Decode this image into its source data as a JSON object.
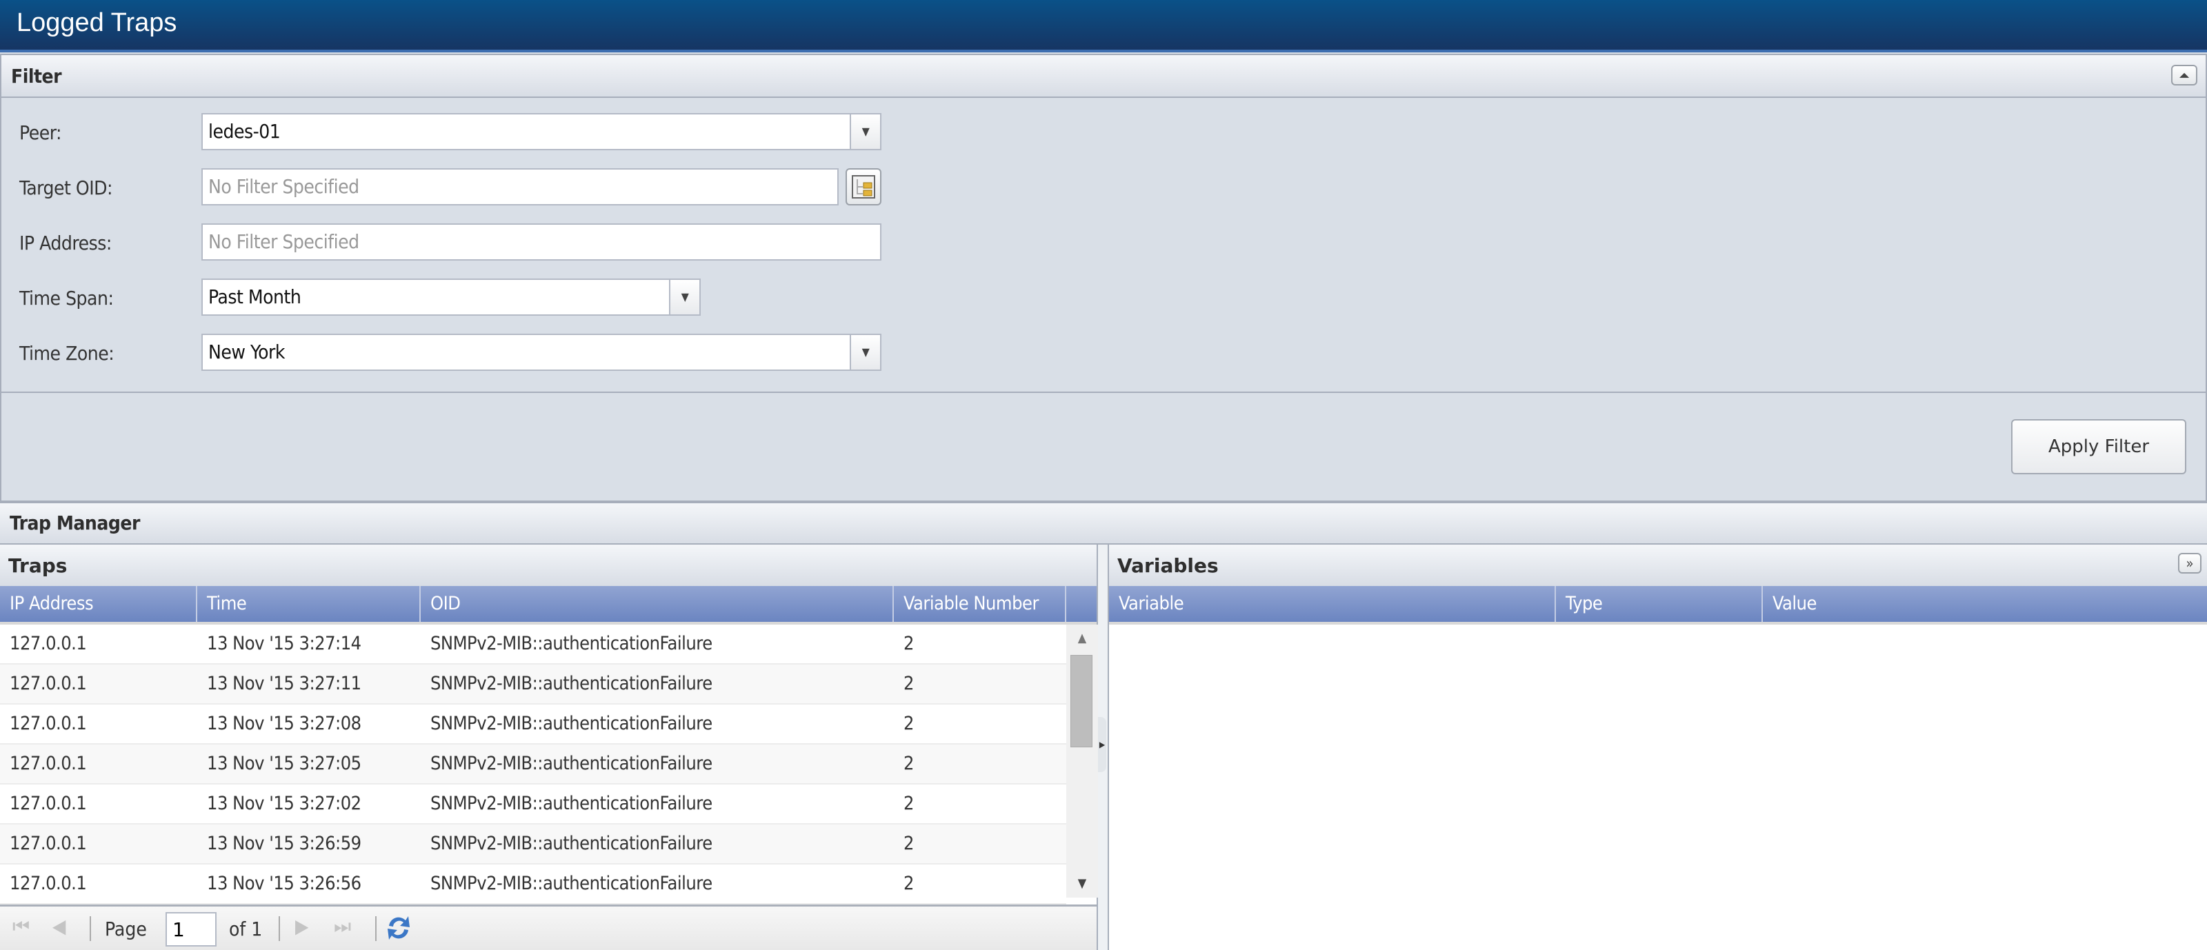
{
  "window": {
    "title": "Logged Traps"
  },
  "filter": {
    "title": "Filter",
    "collapse_icon": "double-chevron-up-icon",
    "fields": {
      "peer": {
        "label": "Peer:",
        "value": "ledes-01"
      },
      "target_oid": {
        "label": "Target OID:",
        "value": "",
        "placeholder": "No Filter Specified"
      },
      "ip_address": {
        "label": "IP Address:",
        "value": "",
        "placeholder": "No Filter Specified"
      },
      "time_span": {
        "label": "Time Span:",
        "value": "Past Month"
      },
      "time_zone": {
        "label": "Time Zone:",
        "value": "New York"
      }
    },
    "apply_label": "Apply Filter"
  },
  "trap_manager": {
    "title": "Trap Manager",
    "traps": {
      "title": "Traps",
      "columns": [
        "IP Address",
        "Time",
        "OID",
        "Variable Number"
      ],
      "rows": [
        [
          "127.0.0.1",
          "13 Nov '15 3:27:14",
          "SNMPv2-MIB::authenticationFailure",
          "2"
        ],
        [
          "127.0.0.1",
          "13 Nov '15 3:27:11",
          "SNMPv2-MIB::authenticationFailure",
          "2"
        ],
        [
          "127.0.0.1",
          "13 Nov '15 3:27:08",
          "SNMPv2-MIB::authenticationFailure",
          "2"
        ],
        [
          "127.0.0.1",
          "13 Nov '15 3:27:05",
          "SNMPv2-MIB::authenticationFailure",
          "2"
        ],
        [
          "127.0.0.1",
          "13 Nov '15 3:27:02",
          "SNMPv2-MIB::authenticationFailure",
          "2"
        ],
        [
          "127.0.0.1",
          "13 Nov '15 3:26:59",
          "SNMPv2-MIB::authenticationFailure",
          "2"
        ],
        [
          "127.0.0.1",
          "13 Nov '15 3:26:56",
          "SNMPv2-MIB::authenticationFailure",
          "2"
        ]
      ],
      "pager": {
        "page_label": "Page",
        "page": "1",
        "of_label": "of 1"
      }
    },
    "variables": {
      "title": "Variables",
      "columns": [
        "Variable",
        "Type",
        "Value"
      ],
      "rows": []
    }
  },
  "colors": {
    "title_bar": "#163563",
    "column_header": "#7b93c9",
    "panel_bg": "#d9dfe7"
  }
}
